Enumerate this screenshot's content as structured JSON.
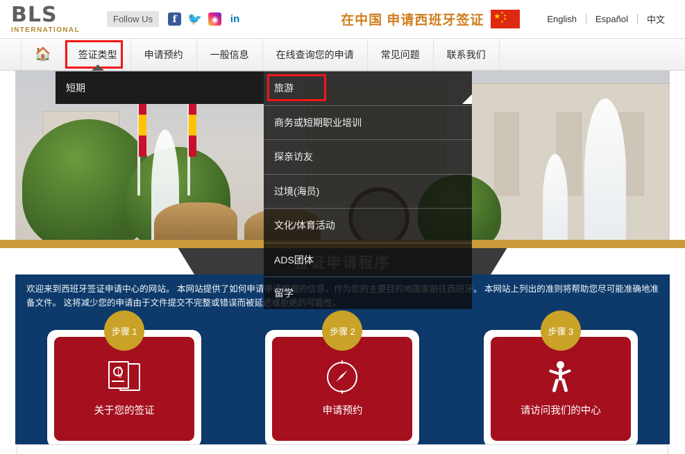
{
  "header": {
    "logo_main": "BLS",
    "logo_sub": "INTERNATIONAL",
    "follow_label": "Follow Us",
    "socials": [
      {
        "name": "facebook-icon",
        "glyph": "f"
      },
      {
        "name": "twitter-icon",
        "glyph": "ᵕ"
      },
      {
        "name": "instagram-icon",
        "glyph": "▢"
      },
      {
        "name": "linkedin-icon",
        "glyph": "in"
      }
    ],
    "title": "在中国 申请西班牙签证",
    "flag_name": "china-flag",
    "languages": [
      "English",
      "Español",
      "中文"
    ]
  },
  "nav": {
    "home_icon": "home-icon",
    "items": [
      "签证类型",
      "申请预约",
      "一般信息",
      "在线查询您的申请",
      "常见问题",
      "联系我们"
    ],
    "active_index": 0,
    "highlight_color": "#f21616"
  },
  "dropdown": {
    "category_label": "短期",
    "items": [
      "旅游",
      "商务或短期职业培训",
      "探亲访友",
      "过境(海员)",
      "文化/体育活动",
      "ADS团体"
    ],
    "tail_item": "留学",
    "highlighted_index": 0
  },
  "banner": {
    "title": "签证申请程序",
    "gold_color": "#c99b3a"
  },
  "info": {
    "text": "欢迎来到西班牙签证申请中心的网站。 本网站提供了如何申请申请根据的信息，作为您的主要目的地国家前往西班牙。 本网站上列出的准则将帮助您尽可能准确地准备文件。 这将减少您的申请由于文件提交不完整或错误而被延迟或拒绝的可能性。",
    "panel_color": "#0d3a6b"
  },
  "steps": [
    {
      "badge": "步骤 1",
      "label": "关于您的签证",
      "icon": "passport-icon"
    },
    {
      "badge": "步骤 2",
      "label": "申请预约",
      "icon": "compass-icon"
    },
    {
      "badge": "步骤 3",
      "label": "请访问我们的中心",
      "icon": "walking-person-icon"
    }
  ],
  "colors": {
    "card_red": "#a50f1e",
    "badge_gold": "#c9a227",
    "panel_blue": "#0d3a6b"
  }
}
